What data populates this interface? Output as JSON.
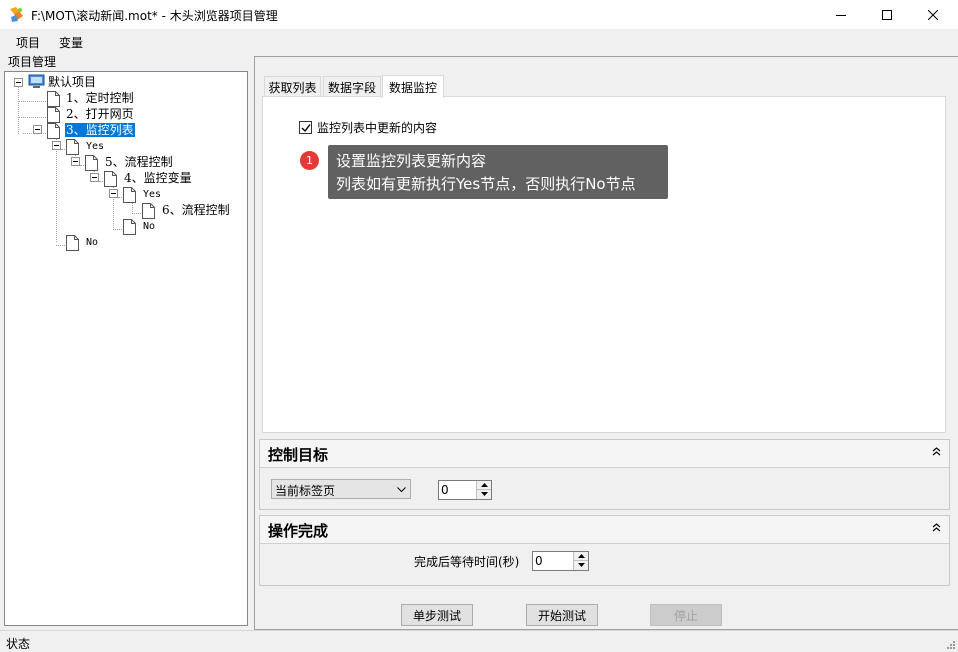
{
  "window": {
    "title": "F:\\MOT\\滚动新闻.mot* - 木头浏览器项目管理"
  },
  "menu": {
    "items": [
      "项目",
      "变量"
    ]
  },
  "left_panel": {
    "label": "项目管理",
    "tree": [
      {
        "label": "默认项目",
        "type": "root"
      },
      {
        "label": "1、定时控制"
      },
      {
        "label": "2、打开网页"
      },
      {
        "label": "3、监控列表",
        "selected": true
      },
      {
        "label": "Yes"
      },
      {
        "label": "5、流程控制"
      },
      {
        "label": "4、监控变量"
      },
      {
        "label": "Yes"
      },
      {
        "label": "6、流程控制"
      },
      {
        "label": "No"
      },
      {
        "label": "No"
      }
    ]
  },
  "tabs": [
    "获取列表",
    "数据字段",
    "数据监控"
  ],
  "active_tab": "数据监控",
  "monitor": {
    "checkbox_label": "监控列表中更新的内容",
    "checked": true
  },
  "tooltip": {
    "badge": "1",
    "line1": "设置监控列表更新内容",
    "line2": "列表如有更新执行Yes节点，否则执行No节点"
  },
  "control_target": {
    "title": "控制目标",
    "select_value": "当前标签页",
    "number_value": "0"
  },
  "operation_done": {
    "title": "操作完成",
    "wait_label": "完成后等待时间(秒)",
    "wait_value": "0"
  },
  "buttons": {
    "step_test": "单步测试",
    "start_test": "开始测试",
    "stop": "停止"
  },
  "status": {
    "text": "状态"
  },
  "colors": {
    "selection": "#0078d7",
    "tooltip_bg": "#616161",
    "badge": "#e53935"
  }
}
